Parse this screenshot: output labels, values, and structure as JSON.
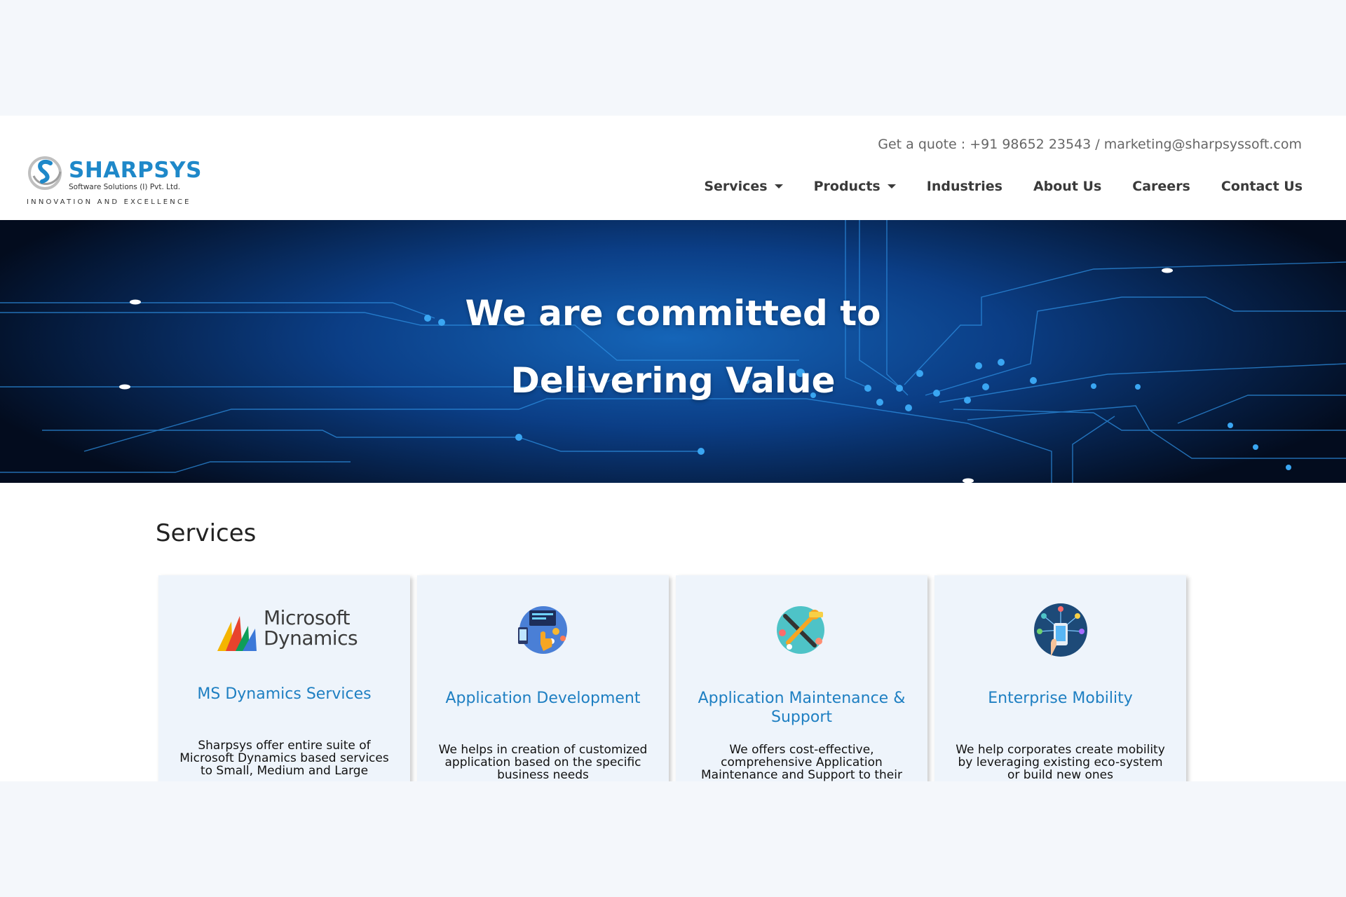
{
  "brand": {
    "name": "SHARPSYS",
    "subtitle": "Software Solutions (I) Pvt. Ltd.",
    "tagline": "INNOVATION AND EXCELLENCE",
    "color": "#1e88c9"
  },
  "header": {
    "quote": "Get a quote : +91 98652 23543 / marketing@sharpsyssoft.com",
    "nav": [
      {
        "label": "Services",
        "dropdown": true
      },
      {
        "label": "Products",
        "dropdown": true
      },
      {
        "label": "Industries",
        "dropdown": false
      },
      {
        "label": "About Us",
        "dropdown": false
      },
      {
        "label": "Careers",
        "dropdown": false
      },
      {
        "label": "Contact Us",
        "dropdown": false
      }
    ]
  },
  "hero": {
    "line1": "We are committed to",
    "line2": "Delivering Value"
  },
  "services": {
    "title": "Services",
    "cards": [
      {
        "icon": "microsoft-dynamics-logo",
        "logo_text_1": "Microsoft",
        "logo_text_2": "Dynamics",
        "title": "MS Dynamics Services",
        "desc": "Sharpsys offer entire suite of Microsoft Dynamics based services to Small, Medium and Large"
      },
      {
        "icon": "app-development-icon",
        "title": "Application Development",
        "desc": "We helps in creation of customized application based on the specific business needs"
      },
      {
        "icon": "maintenance-tools-icon",
        "title": "Application Maintenance & Support",
        "desc": "We offers cost-effective, comprehensive Application Maintenance and Support to their"
      },
      {
        "icon": "mobility-phone-icon",
        "title": "Enterprise Mobility",
        "desc": "We help corporates create mobility by leveraging existing eco-system or build new ones"
      }
    ]
  },
  "colors": {
    "accent": "#1e7fc2",
    "hero_dark": "#06224c",
    "hero_light": "#1565b8",
    "card_bg": "#eef4fb"
  }
}
